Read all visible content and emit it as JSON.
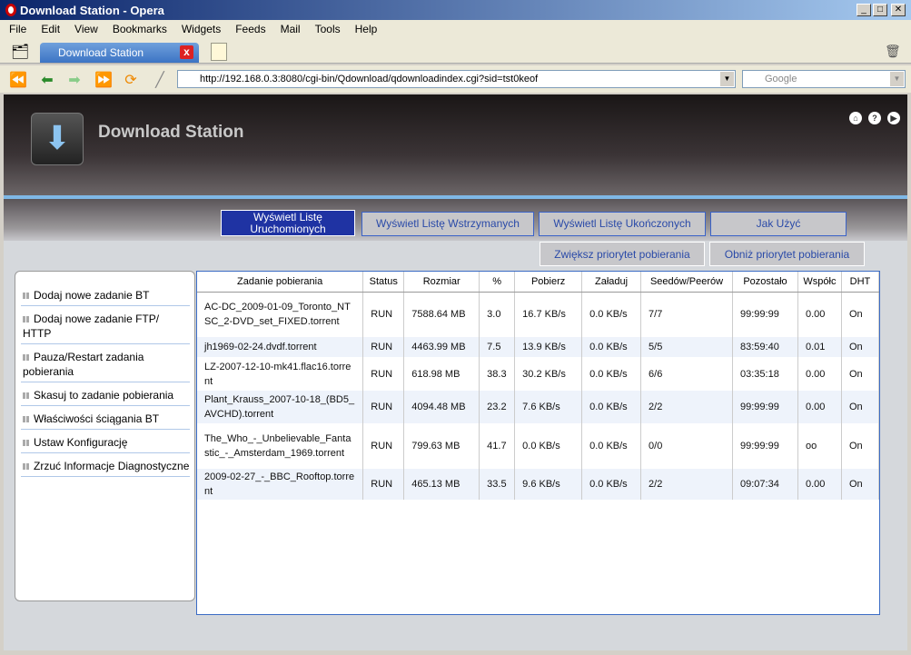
{
  "window": {
    "title": "Download Station - Opera"
  },
  "menu": [
    "File",
    "Edit",
    "View",
    "Bookmarks",
    "Widgets",
    "Feeds",
    "Mail",
    "Tools",
    "Help"
  ],
  "tab": {
    "label": "Download Station"
  },
  "address": {
    "url": "http://192.168.0.3:8080/cgi-bin/Qdownload/qdownloadindex.cgi?sid=tst0keof",
    "search_placeholder": "Google"
  },
  "app": {
    "title": "Download Station"
  },
  "tabs": [
    {
      "label": "Wyświetl Listę Uruchomionych",
      "active": true
    },
    {
      "label": "Wyświetl Listę Wstrzymanych"
    },
    {
      "label": "Wyświetl Listę Ukończonych"
    },
    {
      "label": "Jak Użyć"
    }
  ],
  "priority": {
    "raise": "Zwiększ priorytet pobierania",
    "lower": "Obniż priorytet pobierania"
  },
  "sidebar": [
    "Dodaj nowe zadanie BT",
    "Dodaj nowe zadanie FTP/ HTTP",
    "Pauza/Restart zadania pobierania",
    "Skasuj to zadanie pobierania",
    "Właściwości ściągania BT",
    "Ustaw Konfigurację",
    "Zrzuć Informacje Diagnostyczne"
  ],
  "table": {
    "columns": [
      "Zadanie pobierania",
      "Status",
      "Rozmiar",
      "%",
      "Pobierz",
      "Załaduj",
      "Seedów/Peerów",
      "Pozostało",
      "Współc",
      "DHT"
    ],
    "rows": [
      [
        "AC-DC_2009-01-09_Toronto_NTSC_2-DVD_set_FIXED.torrent",
        "RUN",
        "7588.64 MB",
        "3.0",
        "16.7 KB/s",
        "0.0 KB/s",
        "7/7",
        "99:99:99",
        "0.00",
        "On"
      ],
      [
        "jh1969-02-24.dvdf.torrent",
        "RUN",
        "4463.99 MB",
        "7.5",
        "13.9 KB/s",
        "0.0 KB/s",
        "5/5",
        "83:59:40",
        "0.01",
        "On"
      ],
      [
        "LZ-2007-12-10-mk41.flac16.torrent",
        "RUN",
        "618.98 MB",
        "38.3",
        "30.2 KB/s",
        "0.0 KB/s",
        "6/6",
        "03:35:18",
        "0.00",
        "On"
      ],
      [
        "Plant_Krauss_2007-10-18_(BD5_AVCHD).torrent",
        "RUN",
        "4094.48 MB",
        "23.2",
        "7.6 KB/s",
        "0.0 KB/s",
        "2/2",
        "99:99:99",
        "0.00",
        "On"
      ],
      [
        "The_Who_-_Unbelievable_Fantastic_-_Amsterdam_1969.torrent",
        "RUN",
        "799.63 MB",
        "41.7",
        "0.0 KB/s",
        "0.0 KB/s",
        "0/0",
        "99:99:99",
        "oo",
        "On"
      ],
      [
        "2009-02-27_-_BBC_Rooftop.torrent",
        "RUN",
        "465.13 MB",
        "33.5",
        "9.6 KB/s",
        "0.0 KB/s",
        "2/2",
        "09:07:34",
        "0.00",
        "On"
      ]
    ]
  }
}
